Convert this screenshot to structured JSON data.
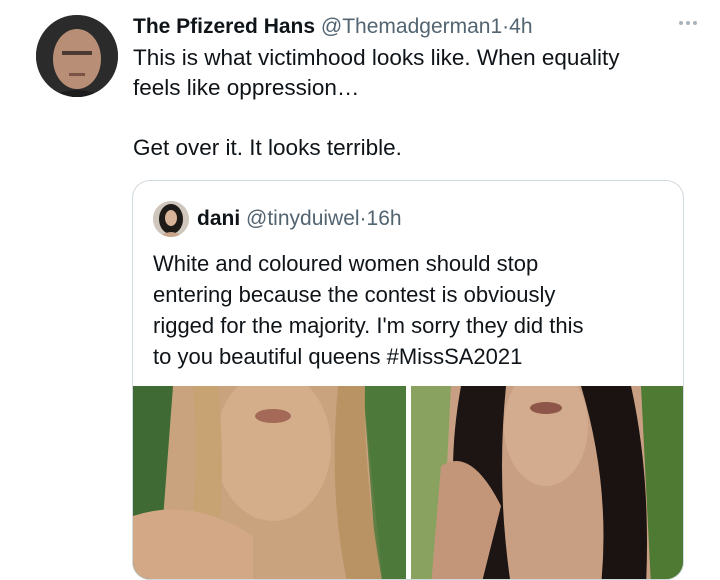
{
  "tweet": {
    "author_name": "The Pfizered Hans",
    "handle": "@Themadgerman1",
    "separator": "·",
    "time": "4h",
    "more_icon": "ellipsis-icon",
    "text_line1": "This is what victimhood looks like. When equality",
    "text_line2": "feels like oppression…",
    "text_line3": "Get over it. It looks terrible."
  },
  "quoted": {
    "author_name": "dani",
    "handle": "@tinyduiwel",
    "separator": "·",
    "time": "16h",
    "text_line1": "White and coloured women should stop",
    "text_line2": "entering because the contest is obviously",
    "text_line3": "rigged for the majority. I'm sorry they did this",
    "text_line4": "to you beautiful queens #MissSA2021"
  },
  "colors": {
    "text": "#0f1419",
    "muted": "#536471",
    "border": "#cfd9de"
  }
}
